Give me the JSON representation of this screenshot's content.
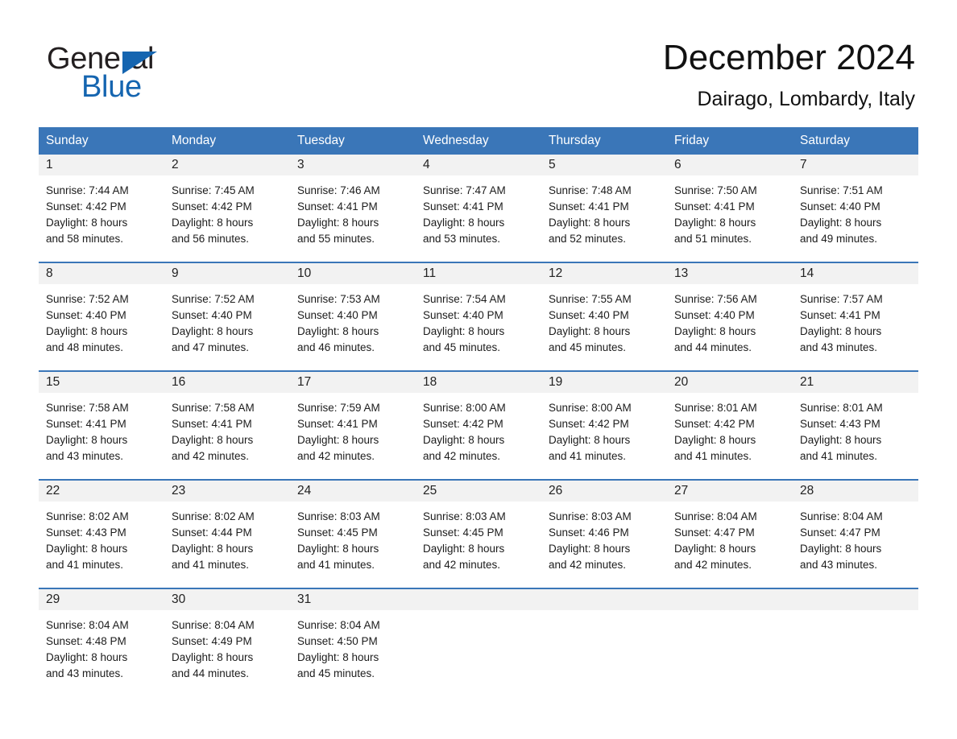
{
  "brand": {
    "name_part1": "General",
    "name_part2": "Blue",
    "logo_icon": "blue-triangle",
    "color_primary": "#1565b0"
  },
  "header": {
    "title": "December 2024",
    "subtitle": "Dairago, Lombardy, Italy"
  },
  "theme": {
    "header_blue": "#3a76b8",
    "daynum_band_gray": "#f2f2f2",
    "text": "#1c1c1c"
  },
  "calendar": {
    "weekday_headers": [
      "Sunday",
      "Monday",
      "Tuesday",
      "Wednesday",
      "Thursday",
      "Friday",
      "Saturday"
    ],
    "weeks": [
      [
        {
          "day": "1",
          "sunrise": "Sunrise: 7:44 AM",
          "sunset": "Sunset: 4:42 PM",
          "daylight_line1": "Daylight: 8 hours",
          "daylight_line2": "and 58 minutes."
        },
        {
          "day": "2",
          "sunrise": "Sunrise: 7:45 AM",
          "sunset": "Sunset: 4:42 PM",
          "daylight_line1": "Daylight: 8 hours",
          "daylight_line2": "and 56 minutes."
        },
        {
          "day": "3",
          "sunrise": "Sunrise: 7:46 AM",
          "sunset": "Sunset: 4:41 PM",
          "daylight_line1": "Daylight: 8 hours",
          "daylight_line2": "and 55 minutes."
        },
        {
          "day": "4",
          "sunrise": "Sunrise: 7:47 AM",
          "sunset": "Sunset: 4:41 PM",
          "daylight_line1": "Daylight: 8 hours",
          "daylight_line2": "and 53 minutes."
        },
        {
          "day": "5",
          "sunrise": "Sunrise: 7:48 AM",
          "sunset": "Sunset: 4:41 PM",
          "daylight_line1": "Daylight: 8 hours",
          "daylight_line2": "and 52 minutes."
        },
        {
          "day": "6",
          "sunrise": "Sunrise: 7:50 AM",
          "sunset": "Sunset: 4:41 PM",
          "daylight_line1": "Daylight: 8 hours",
          "daylight_line2": "and 51 minutes."
        },
        {
          "day": "7",
          "sunrise": "Sunrise: 7:51 AM",
          "sunset": "Sunset: 4:40 PM",
          "daylight_line1": "Daylight: 8 hours",
          "daylight_line2": "and 49 minutes."
        }
      ],
      [
        {
          "day": "8",
          "sunrise": "Sunrise: 7:52 AM",
          "sunset": "Sunset: 4:40 PM",
          "daylight_line1": "Daylight: 8 hours",
          "daylight_line2": "and 48 minutes."
        },
        {
          "day": "9",
          "sunrise": "Sunrise: 7:52 AM",
          "sunset": "Sunset: 4:40 PM",
          "daylight_line1": "Daylight: 8 hours",
          "daylight_line2": "and 47 minutes."
        },
        {
          "day": "10",
          "sunrise": "Sunrise: 7:53 AM",
          "sunset": "Sunset: 4:40 PM",
          "daylight_line1": "Daylight: 8 hours",
          "daylight_line2": "and 46 minutes."
        },
        {
          "day": "11",
          "sunrise": "Sunrise: 7:54 AM",
          "sunset": "Sunset: 4:40 PM",
          "daylight_line1": "Daylight: 8 hours",
          "daylight_line2": "and 45 minutes."
        },
        {
          "day": "12",
          "sunrise": "Sunrise: 7:55 AM",
          "sunset": "Sunset: 4:40 PM",
          "daylight_line1": "Daylight: 8 hours",
          "daylight_line2": "and 45 minutes."
        },
        {
          "day": "13",
          "sunrise": "Sunrise: 7:56 AM",
          "sunset": "Sunset: 4:40 PM",
          "daylight_line1": "Daylight: 8 hours",
          "daylight_line2": "and 44 minutes."
        },
        {
          "day": "14",
          "sunrise": "Sunrise: 7:57 AM",
          "sunset": "Sunset: 4:41 PM",
          "daylight_line1": "Daylight: 8 hours",
          "daylight_line2": "and 43 minutes."
        }
      ],
      [
        {
          "day": "15",
          "sunrise": "Sunrise: 7:58 AM",
          "sunset": "Sunset: 4:41 PM",
          "daylight_line1": "Daylight: 8 hours",
          "daylight_line2": "and 43 minutes."
        },
        {
          "day": "16",
          "sunrise": "Sunrise: 7:58 AM",
          "sunset": "Sunset: 4:41 PM",
          "daylight_line1": "Daylight: 8 hours",
          "daylight_line2": "and 42 minutes."
        },
        {
          "day": "17",
          "sunrise": "Sunrise: 7:59 AM",
          "sunset": "Sunset: 4:41 PM",
          "daylight_line1": "Daylight: 8 hours",
          "daylight_line2": "and 42 minutes."
        },
        {
          "day": "18",
          "sunrise": "Sunrise: 8:00 AM",
          "sunset": "Sunset: 4:42 PM",
          "daylight_line1": "Daylight: 8 hours",
          "daylight_line2": "and 42 minutes."
        },
        {
          "day": "19",
          "sunrise": "Sunrise: 8:00 AM",
          "sunset": "Sunset: 4:42 PM",
          "daylight_line1": "Daylight: 8 hours",
          "daylight_line2": "and 41 minutes."
        },
        {
          "day": "20",
          "sunrise": "Sunrise: 8:01 AM",
          "sunset": "Sunset: 4:42 PM",
          "daylight_line1": "Daylight: 8 hours",
          "daylight_line2": "and 41 minutes."
        },
        {
          "day": "21",
          "sunrise": "Sunrise: 8:01 AM",
          "sunset": "Sunset: 4:43 PM",
          "daylight_line1": "Daylight: 8 hours",
          "daylight_line2": "and 41 minutes."
        }
      ],
      [
        {
          "day": "22",
          "sunrise": "Sunrise: 8:02 AM",
          "sunset": "Sunset: 4:43 PM",
          "daylight_line1": "Daylight: 8 hours",
          "daylight_line2": "and 41 minutes."
        },
        {
          "day": "23",
          "sunrise": "Sunrise: 8:02 AM",
          "sunset": "Sunset: 4:44 PM",
          "daylight_line1": "Daylight: 8 hours",
          "daylight_line2": "and 41 minutes."
        },
        {
          "day": "24",
          "sunrise": "Sunrise: 8:03 AM",
          "sunset": "Sunset: 4:45 PM",
          "daylight_line1": "Daylight: 8 hours",
          "daylight_line2": "and 41 minutes."
        },
        {
          "day": "25",
          "sunrise": "Sunrise: 8:03 AM",
          "sunset": "Sunset: 4:45 PM",
          "daylight_line1": "Daylight: 8 hours",
          "daylight_line2": "and 42 minutes."
        },
        {
          "day": "26",
          "sunrise": "Sunrise: 8:03 AM",
          "sunset": "Sunset: 4:46 PM",
          "daylight_line1": "Daylight: 8 hours",
          "daylight_line2": "and 42 minutes."
        },
        {
          "day": "27",
          "sunrise": "Sunrise: 8:04 AM",
          "sunset": "Sunset: 4:47 PM",
          "daylight_line1": "Daylight: 8 hours",
          "daylight_line2": "and 42 minutes."
        },
        {
          "day": "28",
          "sunrise": "Sunrise: 8:04 AM",
          "sunset": "Sunset: 4:47 PM",
          "daylight_line1": "Daylight: 8 hours",
          "daylight_line2": "and 43 minutes."
        }
      ],
      [
        {
          "day": "29",
          "sunrise": "Sunrise: 8:04 AM",
          "sunset": "Sunset: 4:48 PM",
          "daylight_line1": "Daylight: 8 hours",
          "daylight_line2": "and 43 minutes."
        },
        {
          "day": "30",
          "sunrise": "Sunrise: 8:04 AM",
          "sunset": "Sunset: 4:49 PM",
          "daylight_line1": "Daylight: 8 hours",
          "daylight_line2": "and 44 minutes."
        },
        {
          "day": "31",
          "sunrise": "Sunrise: 8:04 AM",
          "sunset": "Sunset: 4:50 PM",
          "daylight_line1": "Daylight: 8 hours",
          "daylight_line2": "and 45 minutes."
        },
        {
          "day": "",
          "sunrise": "",
          "sunset": "",
          "daylight_line1": "",
          "daylight_line2": ""
        },
        {
          "day": "",
          "sunrise": "",
          "sunset": "",
          "daylight_line1": "",
          "daylight_line2": ""
        },
        {
          "day": "",
          "sunrise": "",
          "sunset": "",
          "daylight_line1": "",
          "daylight_line2": ""
        },
        {
          "day": "",
          "sunrise": "",
          "sunset": "",
          "daylight_line1": "",
          "daylight_line2": ""
        }
      ]
    ]
  }
}
